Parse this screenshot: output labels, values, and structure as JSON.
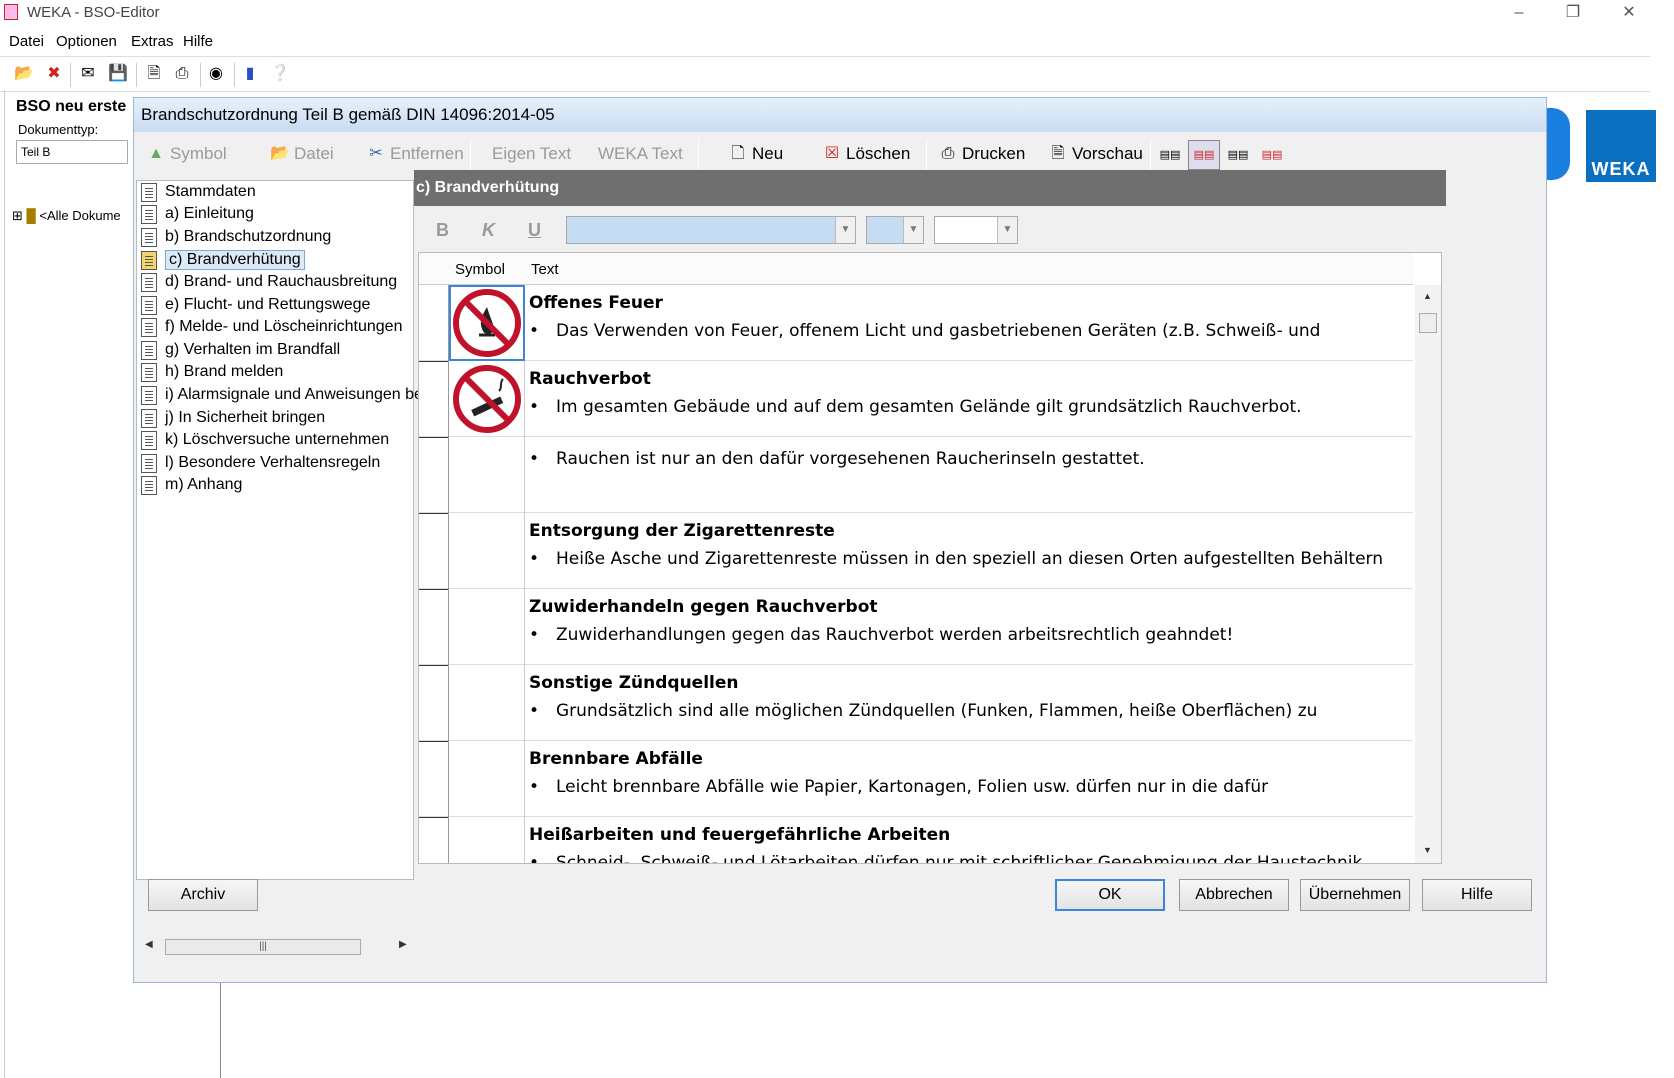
{
  "window": {
    "title": "WEKA - BSO-Editor"
  },
  "menu": [
    "Datei",
    "Optionen",
    "Extras",
    "Hilfe"
  ],
  "main_toolbar_icons": [
    "open-folder-icon",
    "close-doc-icon",
    "print-preview-icon",
    "save-icon",
    "page-preview-icon",
    "printer-icon",
    "binoculars-icon",
    "book-icon",
    "help-icon"
  ],
  "background": {
    "panel_title": "BSO neu erste",
    "doc_type_label": "Dokumenttyp:",
    "doc_type_value": "Teil B",
    "tree_item": "<Alle Dokume",
    "logo_text": "WEKA"
  },
  "dialog": {
    "title": "Brandschutzordnung Teil B gemäß DIN 14096:2014-05",
    "toolbar": {
      "symbol": "Symbol",
      "datei": "Datei",
      "entfernen": "Entfernen",
      "eigen_text": "Eigen Text",
      "weka_text": "WEKA Text",
      "neu": "Neu",
      "loeschen": "Löschen",
      "drucken": "Drucken",
      "vorschau": "Vorschau"
    },
    "tree": [
      "Stammdaten",
      "a) Einleitung",
      "b) Brandschutzordnung",
      "c) Brandverhütung",
      "d) Brand- und Rauchausbreitung",
      "e) Flucht- und Rettungswege",
      "f) Melde- und Löscheinrichtungen",
      "g) Verhalten im Brandfall",
      "h) Brand melden",
      "i) Alarmsignale und Anweisungen bea",
      "j) In Sicherheit bringen",
      "k) Löschversuche unternehmen",
      "l) Besondere Verhaltensregeln",
      "m) Anhang"
    ],
    "selected_tree_index": 3,
    "section_header": "c) Brandverhütung",
    "format": {
      "bold": "B",
      "italic": "K",
      "underline": "U"
    },
    "grid": {
      "col_symbol": "Symbol",
      "col_text": "Text",
      "rows": [
        {
          "symbol": "no-open-fire-icon",
          "heading": "Offenes Feuer",
          "bullet": "Das Verwenden von Feuer, offenem Licht und gasbetriebenen Geräten (z.B. Schweiß- und"
        },
        {
          "symbol": "no-smoking-icon",
          "heading": "Rauchverbot",
          "bullet": "Im gesamten Gebäude und auf dem gesamten Gelände gilt grundsätzlich Rauchverbot."
        },
        {
          "symbol": "",
          "heading": "",
          "bullet": "Rauchen ist nur an den dafür vorgesehenen Raucherinseln gestattet."
        },
        {
          "symbol": "",
          "heading": "Entsorgung der Zigarettenreste",
          "bullet": "Heiße Asche und Zigarettenreste müssen in den speziell an diesen Orten aufgestellten Behältern"
        },
        {
          "symbol": "",
          "heading": "Zuwiderhandeln gegen Rauchverbot",
          "bullet": "Zuwiderhandlungen gegen das Rauchverbot werden arbeitsrechtlich geahndet!"
        },
        {
          "symbol": "",
          "heading": "Sonstige Zündquellen",
          "bullet": "Grundsätzlich sind alle möglichen Zündquellen (Funken, Flammen, heiße Oberflächen) zu"
        },
        {
          "symbol": "",
          "heading": "Brennbare Abfälle",
          "bullet": "Leicht brennbare Abfälle wie Papier, Kartonagen, Folien usw. dürfen nur in die dafür"
        },
        {
          "symbol": "",
          "heading": "Heißarbeiten und feuergefährliche Arbeiten",
          "bullet": "Schneid-, Schweiß- und Lötarbeiten dürfen nur mit schriftlicher Genehmigung der Haustechnik"
        }
      ]
    },
    "buttons": {
      "archiv": "Archiv",
      "ok": "OK",
      "abbrechen": "Abbrechen",
      "uebernehmen": "Übernehmen",
      "hilfe": "Hilfe"
    }
  }
}
